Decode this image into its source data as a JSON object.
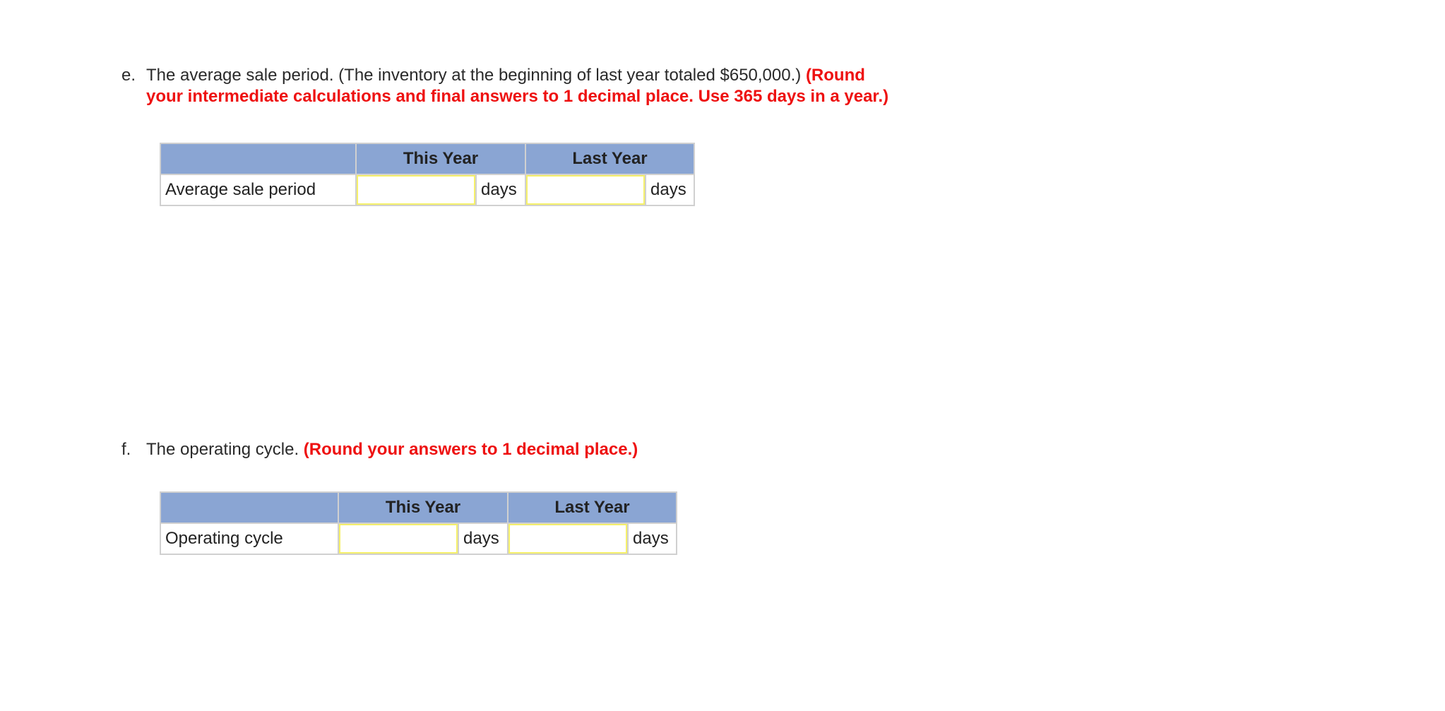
{
  "question_e": {
    "label": "e.",
    "text_line1_plain": "The average sale period. (The inventory at the beginning of last year totaled $650,000.) ",
    "text_line1_red": "(Round",
    "text_line2_red": "your intermediate calculations and final answers to 1 decimal place. Use 365 days in a year.)",
    "table": {
      "headers": [
        "",
        "This Year",
        "Last Year"
      ],
      "row_label": "Average sale period",
      "this_year_value": "",
      "last_year_value": "",
      "unit": "days"
    }
  },
  "question_f": {
    "label": "f.",
    "text_plain": "The operating cycle. ",
    "text_red": "(Round your answers to 1 decimal place.)",
    "table": {
      "headers": [
        "",
        "This Year",
        "Last Year"
      ],
      "row_label": "Operating cycle",
      "this_year_value": "",
      "last_year_value": "",
      "unit": "days"
    }
  },
  "colors": {
    "header_bg": "#8aa5d3",
    "instruction_red": "#ee1111",
    "input_border": "#f5f06a"
  }
}
